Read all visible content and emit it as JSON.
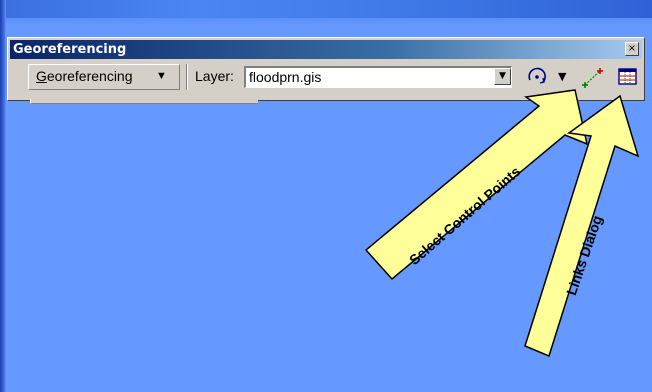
{
  "toolbar": {
    "title": "Georeferencing",
    "close_label": "×",
    "menu": {
      "label_initial": "G",
      "label_rest": "eoreferencing",
      "caret": "▼"
    },
    "layer_label": "Layer:",
    "layer_value": "floodprn.gis",
    "layer_dropdown_caret": "▼",
    "rotate_caret": "▼"
  },
  "callouts": {
    "select_control_points": "Select Control Points",
    "links_dialog": "Links Dialog"
  },
  "colors": {
    "background": "#6699FF",
    "titlebar": "#0A246A",
    "arrow_fill": "#FFFF99",
    "toolbar_face": "#D4D0C8"
  },
  "icons": [
    "rotate-icon",
    "add-control-points-icon",
    "links-table-icon",
    "close-icon",
    "dropdown-arrow-icon"
  ]
}
